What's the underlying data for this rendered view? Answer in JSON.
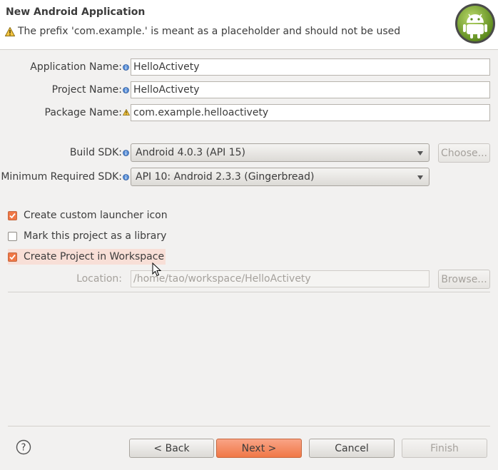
{
  "header": {
    "title": "New Android Application",
    "warning_icon": "warning-icon",
    "message": "The prefix 'com.example.' is meant as a placeholder and should not be used",
    "logo_icon": "android-logo-icon"
  },
  "form": {
    "application_name": {
      "label": "Application Name:",
      "value": "HelloActivety",
      "hint_icon": "info-icon"
    },
    "project_name": {
      "label": "Project Name:",
      "value": "HelloActivety",
      "hint_icon": "info-icon"
    },
    "package_name": {
      "label": "Package Name:",
      "value": "com.example.helloactivety",
      "hint_icon": "warning-icon"
    },
    "build_sdk": {
      "label": "Build SDK:",
      "value": "Android 4.0.3 (API 15)",
      "choose_label": "Choose..."
    },
    "min_sdk": {
      "label": "Minimum Required SDK:",
      "value": "API 10: Android 2.3.3 (Gingerbread)"
    }
  },
  "options": {
    "custom_launcher": {
      "label": "Create custom launcher icon",
      "checked": true
    },
    "library": {
      "label": "Mark this project as a library",
      "checked": false
    },
    "workspace": {
      "label": "Create Project in Workspace",
      "checked": true
    }
  },
  "location": {
    "label": "Location:",
    "value": "/home/tao/workspace/HelloActivety",
    "browse_label": "Browse..."
  },
  "footer": {
    "help_icon": "help-icon",
    "back_label": "< Back",
    "next_label": "Next >",
    "cancel_label": "Cancel",
    "finish_label": "Finish"
  },
  "colors": {
    "accent": "#f07746",
    "highlight": "#f8dfd7",
    "background": "#f2f1f0"
  }
}
